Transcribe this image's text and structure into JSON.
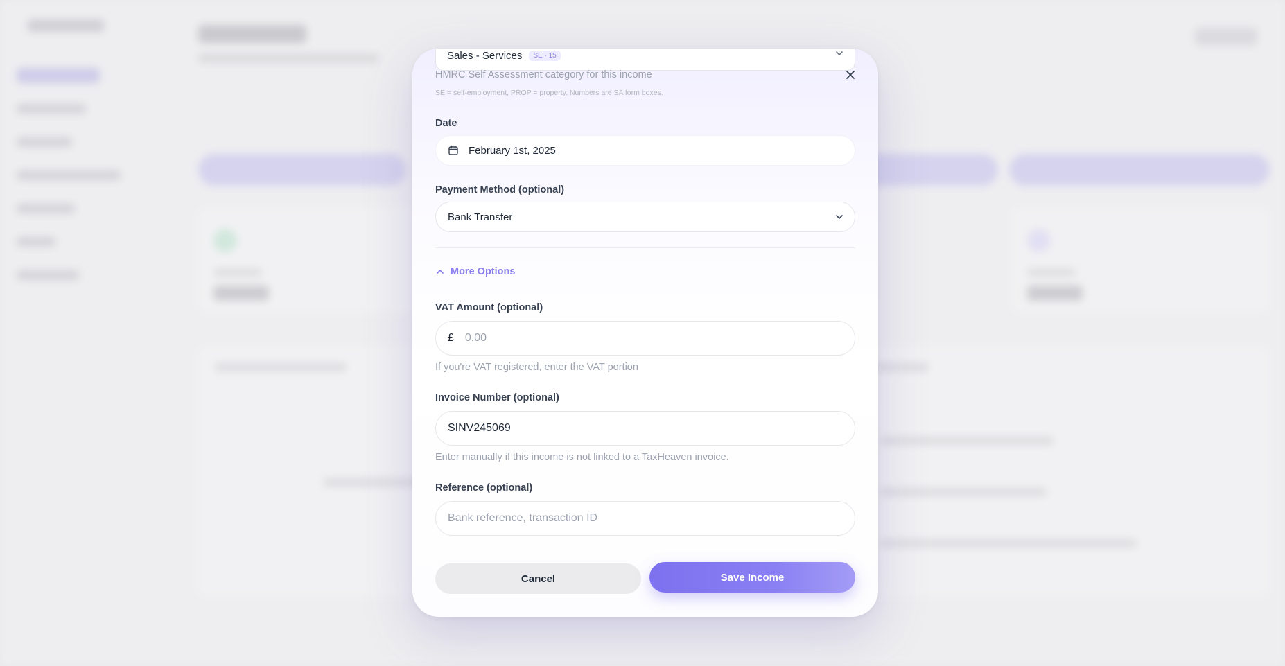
{
  "category": {
    "value": "Sales - Services",
    "badge": "SE · 15",
    "help": "HMRC Self Assessment category for this income",
    "help_small": "SE = self-employment, PROP = property. Numbers are SA form boxes."
  },
  "date": {
    "label": "Date",
    "value": "February 1st, 2025"
  },
  "payment_method": {
    "label": "Payment Method (optional)",
    "value": "Bank Transfer"
  },
  "more_options": {
    "label": "More Options"
  },
  "vat": {
    "label": "VAT Amount (optional)",
    "currency": "£",
    "placeholder": "0.00",
    "hint": "If you're VAT registered, enter the VAT portion"
  },
  "invoice": {
    "label": "Invoice Number (optional)",
    "value": "SINV245069",
    "hint": "Enter manually if this income is not linked to a TaxHeaven invoice."
  },
  "reference": {
    "label": "Reference (optional)",
    "placeholder": "Bank reference, transaction ID"
  },
  "actions": {
    "cancel": "Cancel",
    "save": "Save Income"
  },
  "colors": {
    "accent": "#8b7ff0",
    "save_button": "#7d71ef"
  }
}
